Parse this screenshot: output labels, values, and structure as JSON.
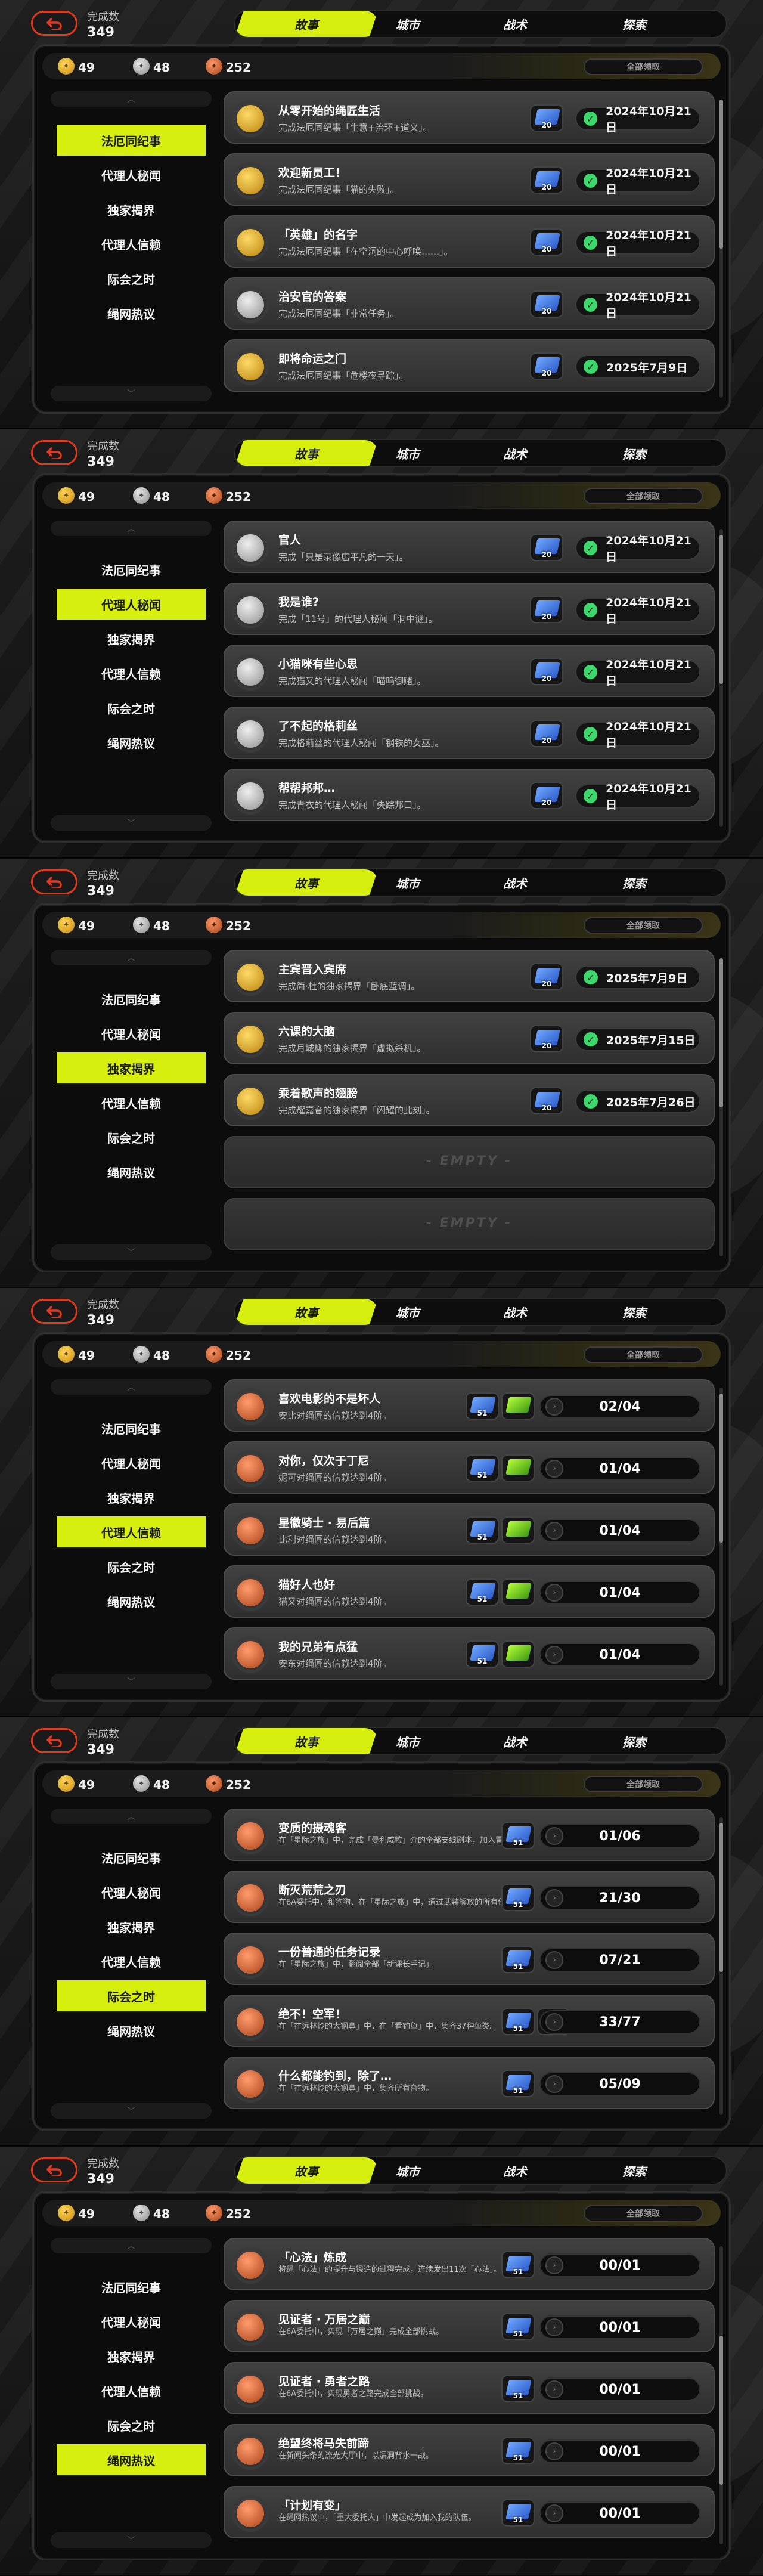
{
  "common": {
    "done_label": "完成数",
    "done_count": "349",
    "tabs": [
      "故事",
      "城市",
      "战术",
      "探索"
    ],
    "stats": [
      "49",
      "48",
      "252"
    ],
    "claim_all": "全部领取",
    "side_items": [
      "法厄同纪事",
      "代理人秘闻",
      "独家揭界",
      "代理人信赖",
      "际会之时",
      "绳网热议"
    ]
  },
  "panels": [
    {
      "active_side": 0,
      "rows": [
        {
          "title": "从零开始的绳匠生活",
          "desc": "完成法厄同纪事「生意+治环+道义」。",
          "medal": "gold",
          "reward": "20",
          "status": "2024年10月21日"
        },
        {
          "title": "欢迎新员工！",
          "desc": "完成法厄同纪事「猫的失败」。",
          "medal": "gold",
          "reward": "20",
          "status": "2024年10月21日"
        },
        {
          "title": "「英雄」的名字",
          "desc": "完成法厄同纪事「在空洞的中心呼唤……」。",
          "medal": "gold",
          "reward": "20",
          "status": "2024年10月21日"
        },
        {
          "title": "治安官的答案",
          "desc": "完成法厄同纪事「非常任务」。",
          "medal": "silver",
          "reward": "20",
          "status": "2024年10月21日"
        },
        {
          "title": "即将命运之门",
          "desc": "完成法厄同纪事「危楼夜寻踪」。",
          "medal": "gold",
          "reward": "20",
          "status": "2025年7月9日"
        }
      ]
    },
    {
      "active_side": 1,
      "rows": [
        {
          "title": "官人",
          "desc": "完成「只是录像店平凡的一天」。",
          "medal": "silver",
          "reward": "20",
          "status": "2024年10月21日"
        },
        {
          "title": "我是谁?",
          "desc": "完成「11号」的代理人秘闻「洞中谜」。",
          "medal": "silver",
          "reward": "20",
          "status": "2024年10月21日"
        },
        {
          "title": "小猫咪有些心思",
          "desc": "完成猫又的代理人秘闻「喵呜御赌」。",
          "medal": "silver",
          "reward": "20",
          "status": "2024年10月21日"
        },
        {
          "title": "了不起的格莉丝",
          "desc": "完成格莉丝的代理人秘闻「钢铁的女巫」。",
          "medal": "silver",
          "reward": "20",
          "status": "2024年10月21日"
        },
        {
          "title": "帮帮邦邦…",
          "desc": "完成青衣的代理人秘闻「失踪邦口」。",
          "medal": "silver",
          "reward": "20",
          "status": "2024年10月21日"
        }
      ]
    },
    {
      "active_side": 2,
      "rows": [
        {
          "title": "主宾晋入宾席",
          "desc": "完成简·杜的独家揭界「卧底蓝调」。",
          "medal": "gold",
          "reward": "20",
          "status": "2025年7月9日"
        },
        {
          "title": "六课的大脑",
          "desc": "完成月城柳的独家揭界「虚拟杀机」。",
          "medal": "gold",
          "reward": "20",
          "status": "2025年7月15日"
        },
        {
          "title": "乘着歌声的翅膀",
          "desc": "完成耀嘉音的独家揭界「闪耀的此刻」。",
          "medal": "gold",
          "reward": "20",
          "status": "2025年7月26日"
        }
      ],
      "empty_label": "- EMPTY -"
    },
    {
      "active_side": 3,
      "rows": [
        {
          "title": "喜欢电影的不是坏人",
          "desc": "安比对绳匠的信赖达到4阶。",
          "medal": "bronze",
          "reward": "51",
          "progress": "02/04"
        },
        {
          "title": "对你，仅次于丁尼",
          "desc": "妮可对绳匠的信赖达到4阶。",
          "medal": "bronze",
          "reward": "51",
          "progress": "01/04"
        },
        {
          "title": "星徽骑士 · 易后篇",
          "desc": "比利对绳匠的信赖达到4阶。",
          "medal": "bronze",
          "reward": "51",
          "progress": "01/04"
        },
        {
          "title": "猫好人也好",
          "desc": "猫又对绳匠的信赖达到4阶。",
          "medal": "bronze",
          "reward": "51",
          "progress": "01/04"
        },
        {
          "title": "我的兄弟有点猛",
          "desc": "安东对绳匠的信赖达到4阶。",
          "medal": "bronze",
          "reward": "51",
          "progress": "01/04"
        }
      ]
    },
    {
      "active_side": 4,
      "rows": [
        {
          "title": "变质的摄魂客",
          "desc": "在「星际之旅」中，完成「曼利咸粒」介的全部支线剧本，加入冒险。",
          "medal": "bronze",
          "reward": "51",
          "progress": "01/06",
          "small": true
        },
        {
          "title": "断灭荒荒之刃",
          "desc": "在6A委托中，和狗狗、在「星际之旅」中，通过武装解放的所有任务。",
          "medal": "bronze",
          "reward": "51",
          "progress": "21/30",
          "small": true
        },
        {
          "title": "一份普通的任务记录",
          "desc": "在「星际之旅」中，翻阅全部「新课长手记」。",
          "medal": "bronze",
          "reward": "51",
          "progress": "07/21",
          "small": true
        },
        {
          "title": "绝不！空军！",
          "desc": "在「在远林岭的大钢鼻」中，在「看钓鱼」中，集齐37种鱼类。",
          "medal": "bronze",
          "reward": "51",
          "progress": "33/77",
          "small": true
        },
        {
          "title": "什么都能钓到，除了…",
          "desc": "在「在远林岭的大钢鼻」中，集齐所有杂物。",
          "medal": "bronze",
          "reward": "51",
          "progress": "05/09",
          "small": true
        }
      ]
    },
    {
      "active_side": 5,
      "rows": [
        {
          "title": "「心法」炼成",
          "desc": "将绳「心法」的提升与锻造的过程完成，连续发出11次「心法」。",
          "medal": "bronze",
          "reward": "51",
          "progress": "00/01",
          "small": true
        },
        {
          "title": "见证者 · 万居之巅",
          "desc": "在6A委托中，实现「万居之巅」完成全部挑战。",
          "medal": "bronze",
          "reward": "51",
          "progress": "00/01",
          "small": true
        },
        {
          "title": "见证者 · 勇者之路",
          "desc": "在6A委托中，实现勇者之路完成全部挑战。",
          "medal": "bronze",
          "reward": "51",
          "progress": "00/01",
          "small": true
        },
        {
          "title": "绝望终将马失前蹄",
          "desc": "在新闻头条的流光大厅中，以漏洞背水一战。",
          "medal": "bronze",
          "reward": "51",
          "progress": "00/01",
          "small": true
        },
        {
          "title": "「计划有变」",
          "desc": "在绳网热议中，「重大委托人」中发起成为加入我的队伍。",
          "medal": "bronze",
          "reward": "51",
          "progress": "00/01",
          "small": true
        }
      ]
    }
  ]
}
